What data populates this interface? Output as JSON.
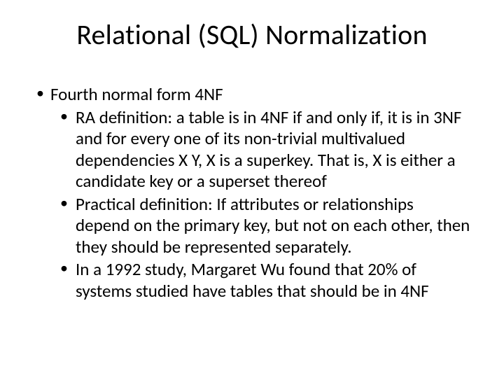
{
  "title": "Relational (SQL) Normalization",
  "bullets": {
    "l1": "Fourth normal form 4NF",
    "sub": [
      "RA definition: a table is in 4NF if and only if, it is in 3NF and for every one of its non-trivial multivalued dependencies X  Y, X is a superkey. That is, X is either a candidate key or a superset thereof",
      "Practical definition: If attributes or relationships depend on the primary key, but not on each other, then they should be represented separately.",
      "In a 1992 study, Margaret Wu found that 20% of systems studied have tables that should be in 4NF"
    ]
  }
}
